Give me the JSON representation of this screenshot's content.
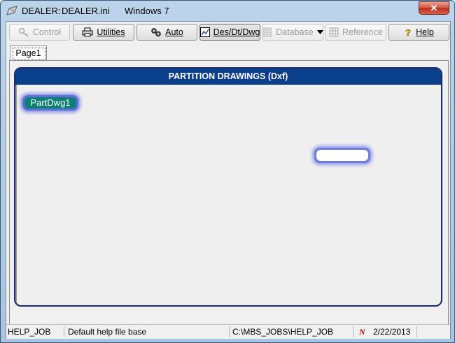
{
  "window": {
    "app_name": "DEALER:",
    "ini_file": "DEALER.ini",
    "os": "Windows 7",
    "close_glyph": "✕"
  },
  "toolbar": {
    "control": "Control",
    "utilities": "Utilities",
    "auto": "Auto",
    "des_dt_dwg": "Des/Dt/Dwg",
    "database": "Database",
    "reference": "Reference",
    "help": "Help"
  },
  "tabs": [
    "Page1"
  ],
  "panel": {
    "title": "PARTITION DRAWINGS (Dxf)",
    "button_label": "PartDwg1"
  },
  "status": {
    "job": "HELP_JOB",
    "description": "Default help file base",
    "path": "C:\\MBS_JOBS\\HELP_JOB",
    "date": "2/22/2013",
    "n_icon_glyph": "N"
  },
  "colors": {
    "header_blue": "#0a3f8c",
    "button_teal": "#0e7f73",
    "glow_blue": "#5f6fd8"
  }
}
